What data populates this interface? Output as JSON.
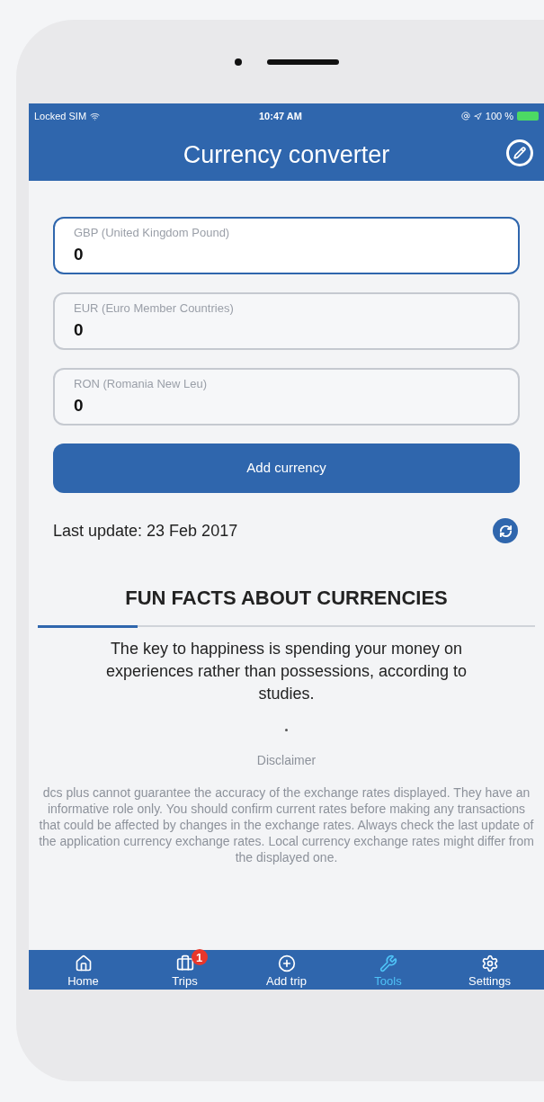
{
  "status_bar": {
    "carrier": "Locked SIM",
    "time": "10:47 AM",
    "battery": "100 %"
  },
  "header": {
    "title": "Currency converter"
  },
  "currencies": [
    {
      "label": "GBP (United Kingdom Pound)",
      "value": "0",
      "selected": true
    },
    {
      "label": "EUR (Euro Member Countries)",
      "value": "0",
      "selected": false
    },
    {
      "label": "RON (Romania New Leu)",
      "value": "0",
      "selected": false
    }
  ],
  "add_button": "Add currency",
  "last_update": "Last update: 23 Feb 2017",
  "facts": {
    "title": "FUN FACTS ABOUT CURRENCIES",
    "text": "The key to happiness is spending your money on experiences rather than possessions, according to studies.",
    "level": 0.2
  },
  "disclaimer": {
    "title": "Disclaimer",
    "text": "dcs plus cannot guarantee the accuracy of the exchange rates displayed. They have an informative role only. You should confirm current rates before making any transactions that could be affected by changes in the exchange rates. Always check the last update of the application currency exchange rates. Local currency exchange rates might differ from the displayed one."
  },
  "tabs": [
    {
      "kind": "home",
      "label": "Home",
      "selected": false
    },
    {
      "kind": "trips",
      "label": "Trips",
      "selected": false,
      "badge": "1"
    },
    {
      "kind": "add",
      "label": "Add trip",
      "selected": false
    },
    {
      "kind": "tools",
      "label": "Tools",
      "selected": true
    },
    {
      "kind": "settings",
      "label": "Settings",
      "selected": false
    }
  ]
}
